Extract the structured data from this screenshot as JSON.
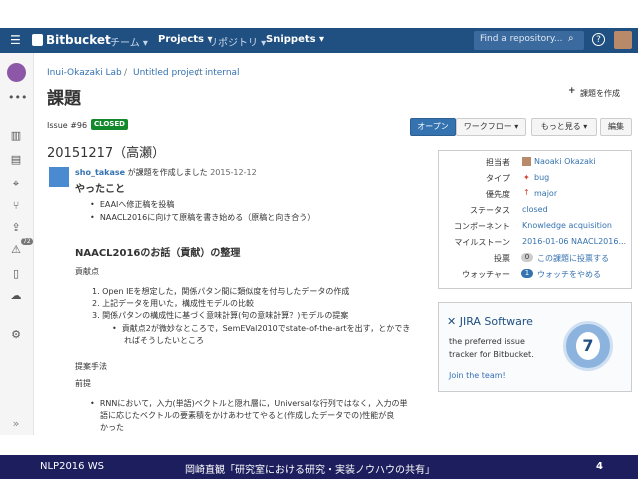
{
  "nav": {
    "logo": "Bitbucket",
    "team": "チーム ▾",
    "projects": "Projects ▾",
    "repos": "リポジトリ ▾",
    "snippets": "Snippets ▾",
    "search_placeholder": "Find a repository...",
    "help": "?"
  },
  "breadcrumb": {
    "owner": "Inui-Okazaki Lab",
    "sep1": "/",
    "project": "Untitled project",
    "sep2": "/",
    "repo": "internal"
  },
  "page": {
    "title": "課題",
    "create_issue": "課題を作成",
    "issue_number": "Issue #96",
    "status_badge": "CLOSED",
    "open_button": "オープン",
    "workflow_button": "ワークフロー ▾",
    "more_button": "もっと見る ▾",
    "edit_button": "編集",
    "issue_title": "20151217（高瀬）"
  },
  "post": {
    "author": "sho_takase",
    "action": "が課題を作成しました",
    "date": "2015-12-12",
    "heading_todo": "やったこと",
    "todo_items": [
      "EAAIへ修正稿を投稿",
      "NAACL2016に向けて原稿を書き始める（原稿と向き合う）"
    ],
    "section_heading": "NAACL2016のお話（貢献）の整理",
    "contribution_label": "貢献点",
    "contribution_items": [
      "1. Open IEを想定した，関係パタン間に類似度を付与したデータの作成",
      "2. 上記データを用いた，構成性モデルの比較",
      "3. 関係パタンの構成性に基づく意味計算(句の意味計算？)モデルの提案"
    ],
    "sub_item_line1": "貢献点2が微妙なところで，SemEVal2010でstate-of-the-artを出す，とかでき",
    "sub_item_line2": "ればそうしたいところ",
    "method_label": "提案手法",
    "premise_label": "前提",
    "premise_line1": "RNNにおいて，入力(単語)ベクトルと隠れ層に，Universalな行列ではなく，入力の単",
    "premise_line2": "語に応じたベクトルの要素積をかけあわせてやると(作成したデータでの)性能が良",
    "premise_line3": "かった"
  },
  "attributes": {
    "assignee_label": "担当者",
    "assignee": "Naoaki Okazaki",
    "type_label": "タイプ",
    "type": "bug",
    "priority_label": "優先度",
    "priority": "major",
    "status_label": "ステータス",
    "status": "closed",
    "component_label": "コンポーネント",
    "component": "Knowledge acquisition",
    "milestone_label": "マイルストーン",
    "milestone": "2016-01-06 NAACL2016...",
    "votes_label": "投票",
    "votes_count": "0",
    "votes_action": "この課題に投票する",
    "watchers_label": "ウォッチャー",
    "watchers_count": "1",
    "watchers_action": "ウォッチをやめる"
  },
  "ad": {
    "brand": "JIRA Software",
    "line1": "the preferred issue",
    "line2": "tracker for Bitbucket.",
    "cta": "Join the team!",
    "badge_number": "7"
  },
  "sidebar": {
    "badge": "72",
    "collapse": "»"
  },
  "footer": {
    "left": "NLP2016 WS",
    "center": "岡崎直観「研究室における研究・実装ノウハウの共有」",
    "page": "4"
  },
  "colors": {
    "nav_bg": "#205081",
    "link": "#3572b0",
    "closed_badge": "#14892c",
    "footer_bg": "#1d1e5e"
  }
}
